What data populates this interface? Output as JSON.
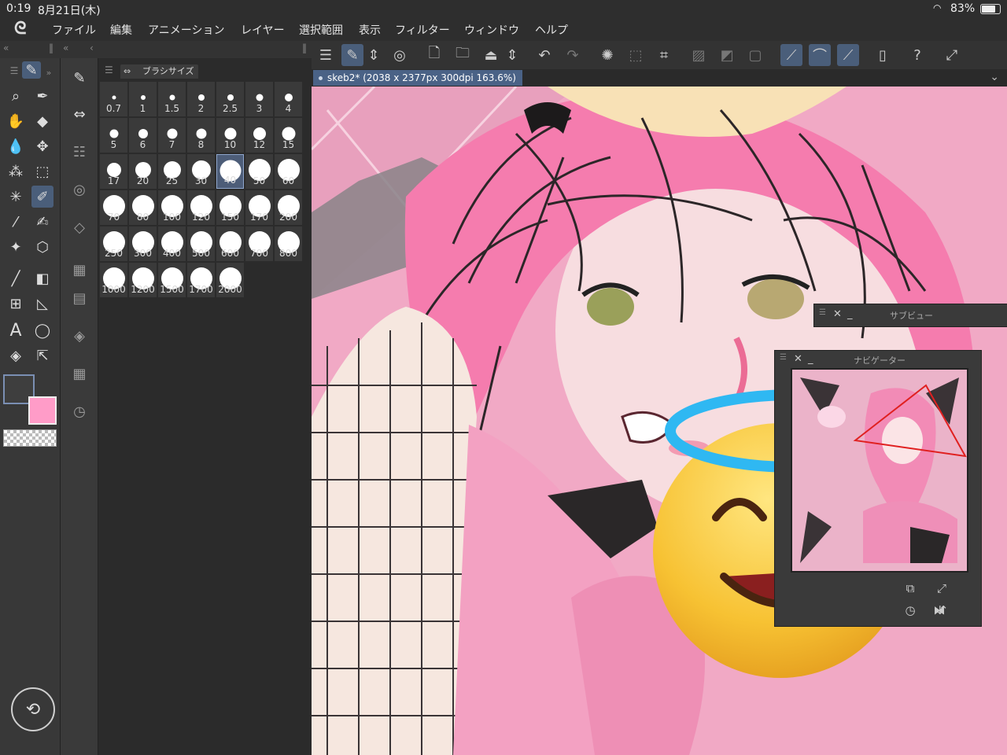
{
  "status": {
    "time": "0:19",
    "date": "8月21日(木)",
    "battery": "83%"
  },
  "menu": [
    "ファイル",
    "編集",
    "アニメーション",
    "レイヤー",
    "選択範囲",
    "表示",
    "フィルター",
    "ウィンドウ",
    "ヘルプ"
  ],
  "document": {
    "tab_title": "skeb2* (2038 x 2377px 300dpi 163.6%)"
  },
  "brush_panel": {
    "title": "ブラシサイズ",
    "selected_size": "40",
    "sizes": [
      "0.7",
      "1",
      "1.5",
      "2",
      "2.5",
      "3",
      "4",
      "5",
      "6",
      "7",
      "8",
      "10",
      "12",
      "15",
      "17",
      "20",
      "25",
      "30",
      "40",
      "50",
      "60",
      "70",
      "80",
      "100",
      "120",
      "150",
      "170",
      "200",
      "250",
      "300",
      "400",
      "500",
      "600",
      "700",
      "800",
      "1000",
      "1200",
      "1500",
      "1700",
      "2000"
    ]
  },
  "subview": {
    "title": "サブビュー"
  },
  "navigator": {
    "title": "ナビゲーター"
  },
  "colors": {
    "main": "#3e3e3e",
    "sub": "#ff9cc8",
    "accent": "#4a6286"
  }
}
